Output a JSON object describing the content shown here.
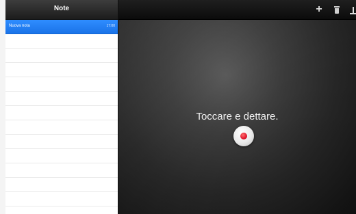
{
  "sidebar": {
    "title": "Note",
    "notes": [
      {
        "title": "Nuova nota",
        "time": "17:00"
      }
    ]
  },
  "main": {
    "prompt": "Toccare e dettare.",
    "toolbar": {
      "add_icon": "plus-icon",
      "delete_icon": "trash-icon",
      "share_icon": "share-icon"
    },
    "mic_icon": "microphone-icon"
  },
  "colors": {
    "selection": "#1a73e8",
    "record": "#e0142b"
  }
}
